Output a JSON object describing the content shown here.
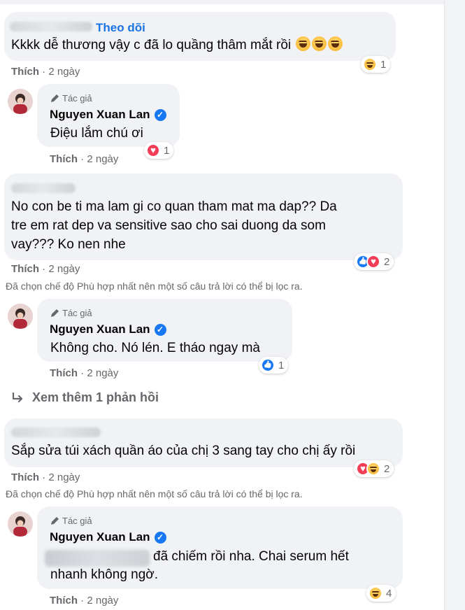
{
  "comments": [
    {
      "follow_label": "Theo dõi",
      "text": "Kkkk dễ thương vậy c đã lo quầng thâm mắt rồi",
      "like_label": "Thích",
      "time": "2 ngày",
      "reaction_count": "1",
      "reactions": [
        "haha-icon"
      ],
      "reply": {
        "author_tag": "Tác giả",
        "author_name": "Nguyen Xuan Lan",
        "text": "Điệu lắm chú ơi",
        "like_label": "Thích",
        "time": "2 ngày",
        "reaction_count": "1",
        "reactions": [
          "heart-icon"
        ]
      }
    },
    {
      "text_line1": "No con be ti ma lam gi co quan tham mat ma dap?? Da",
      "text_line2": "tre em rat dep va sensitive sao cho sai duong da som",
      "text_line3": "vay??? Ko nen nhe",
      "like_label": "Thích",
      "time": "2 ngày",
      "reaction_count": "2",
      "reactions": [
        "like-icon",
        "heart-icon"
      ],
      "filter_note": "Đã chọn chế độ Phù hợp nhất nên một số câu trả lời có thể bị lọc ra.",
      "reply": {
        "author_tag": "Tác giả",
        "author_name": "Nguyen Xuan Lan",
        "text": "Không cho. Nó lén. E tháo ngay mà",
        "like_label": "Thích",
        "time": "2 ngày",
        "reaction_count": "1",
        "reactions": [
          "like-icon"
        ]
      },
      "more_replies": "Xem thêm 1 phản hồi"
    },
    {
      "text": "Sắp sửa túi xách quần áo của chị 3 sang tay cho chị ấy rồi",
      "like_label": "Thích",
      "time": "2 ngày",
      "reaction_count": "2",
      "reactions": [
        "heart-icon",
        "haha-icon"
      ],
      "filter_note": "Đã chọn chế độ Phù hợp nhất nên một số câu trả lời có thể bị lọc ra.",
      "reply": {
        "author_tag": "Tác giả",
        "author_name": "Nguyen Xuan Lan",
        "text_line1": "đã chiếm rồi nha. Chai serum hết",
        "text_line2": "nhanh không ngờ.",
        "like_label": "Thích",
        "time": "2 ngày",
        "reaction_count": "4",
        "reactions": [
          "haha-icon"
        ]
      }
    }
  ],
  "separator": "·",
  "verified_mark": "✓",
  "colors": {
    "link": "#1b74e4",
    "bubble": "#f0f2f5",
    "meta": "#65676b",
    "verified": "#1877f2"
  }
}
